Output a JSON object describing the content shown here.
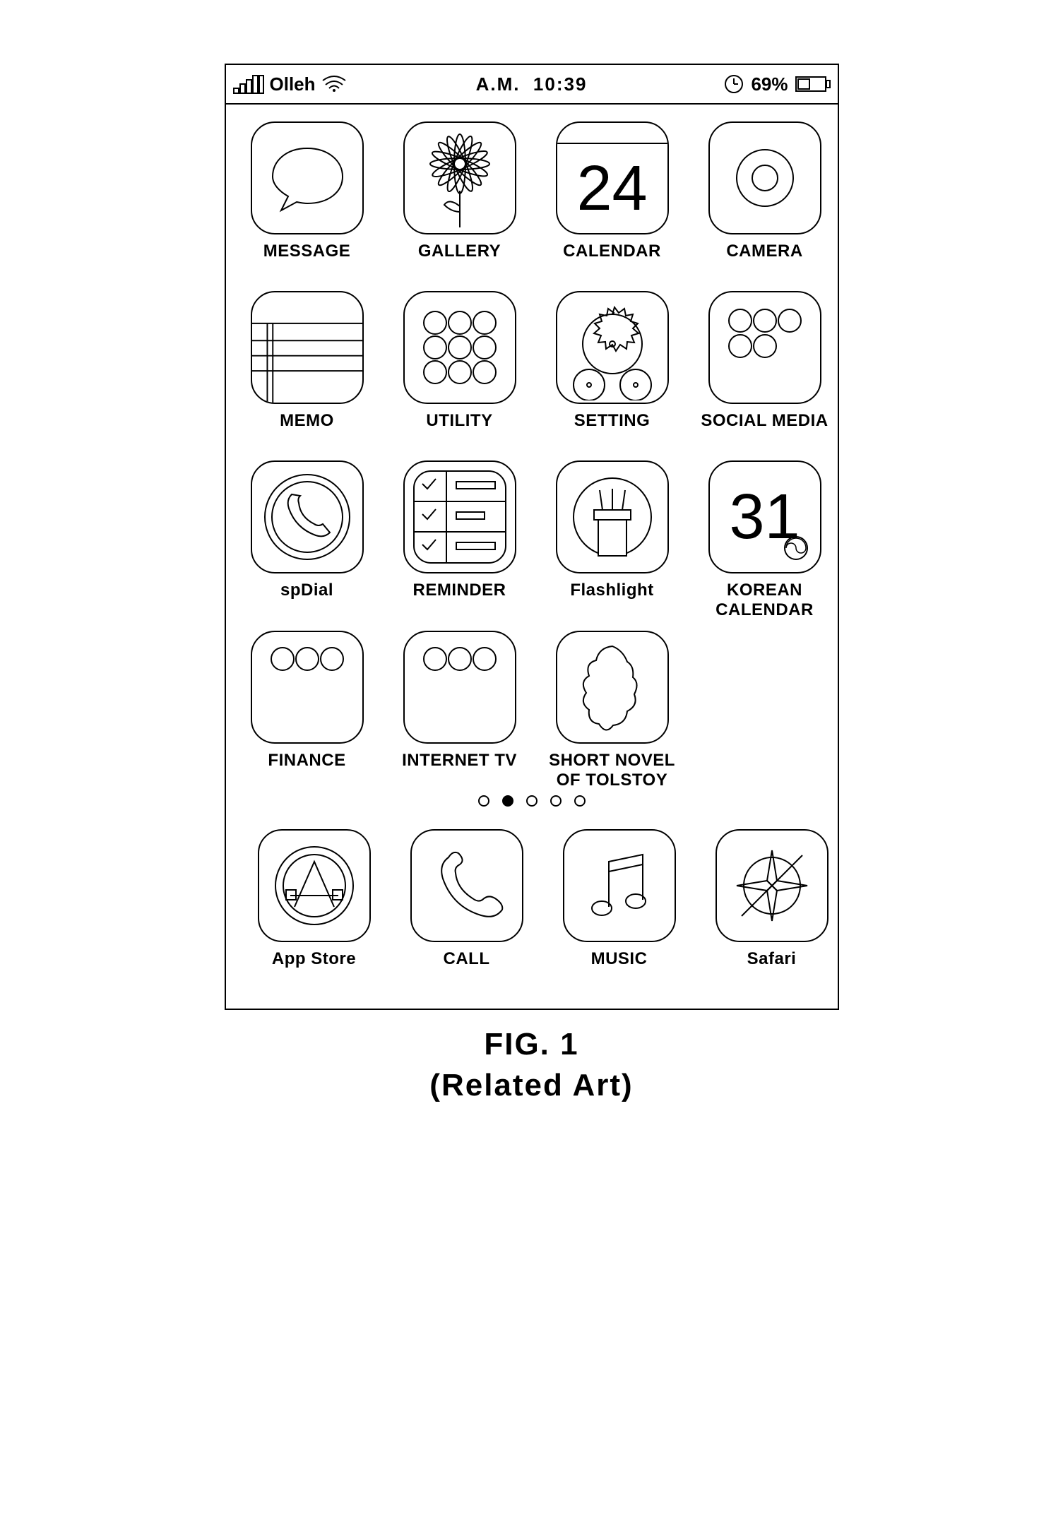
{
  "status_bar": {
    "carrier": "Olleh",
    "time_prefix": "A.M.",
    "time": "10:39",
    "battery_pct": "69%"
  },
  "apps": {
    "row1": [
      {
        "label": "MESSAGE",
        "icon": "message"
      },
      {
        "label": "GALLERY",
        "icon": "gallery"
      },
      {
        "label": "CALENDAR",
        "icon": "calendar",
        "day": "24"
      },
      {
        "label": "CAMERA",
        "icon": "camera"
      }
    ],
    "row2": [
      {
        "label": "MEMO",
        "icon": "memo"
      },
      {
        "label": "UTILITY",
        "icon": "utility"
      },
      {
        "label": "SETTING",
        "icon": "setting"
      },
      {
        "label": "SOCIAL MEDIA",
        "icon": "social"
      }
    ],
    "row3": [
      {
        "label": "spDial",
        "icon": "spdial"
      },
      {
        "label": "REMINDER",
        "icon": "reminder"
      },
      {
        "label": "Flashlight",
        "icon": "flashlight"
      },
      {
        "label": "KOREAN CALENDAR",
        "icon": "kcalendar",
        "day": "31"
      }
    ],
    "row4": [
      {
        "label": "FINANCE",
        "icon": "finance"
      },
      {
        "label": "INTERNET TV",
        "icon": "itv"
      },
      {
        "label": "SHORT NOVEL OF TOLSTOY",
        "icon": "tolstoy"
      },
      {
        "label": "",
        "icon": "empty"
      }
    ],
    "dock": [
      {
        "label": "App Store",
        "icon": "appstore"
      },
      {
        "label": "CALL",
        "icon": "call"
      },
      {
        "label": "MUSIC",
        "icon": "music"
      },
      {
        "label": "Safari",
        "icon": "safari"
      }
    ]
  },
  "page_indicator": {
    "count": 5,
    "active": 1
  },
  "caption_line1": "FIG. 1",
  "caption_line2": "(Related Art)"
}
